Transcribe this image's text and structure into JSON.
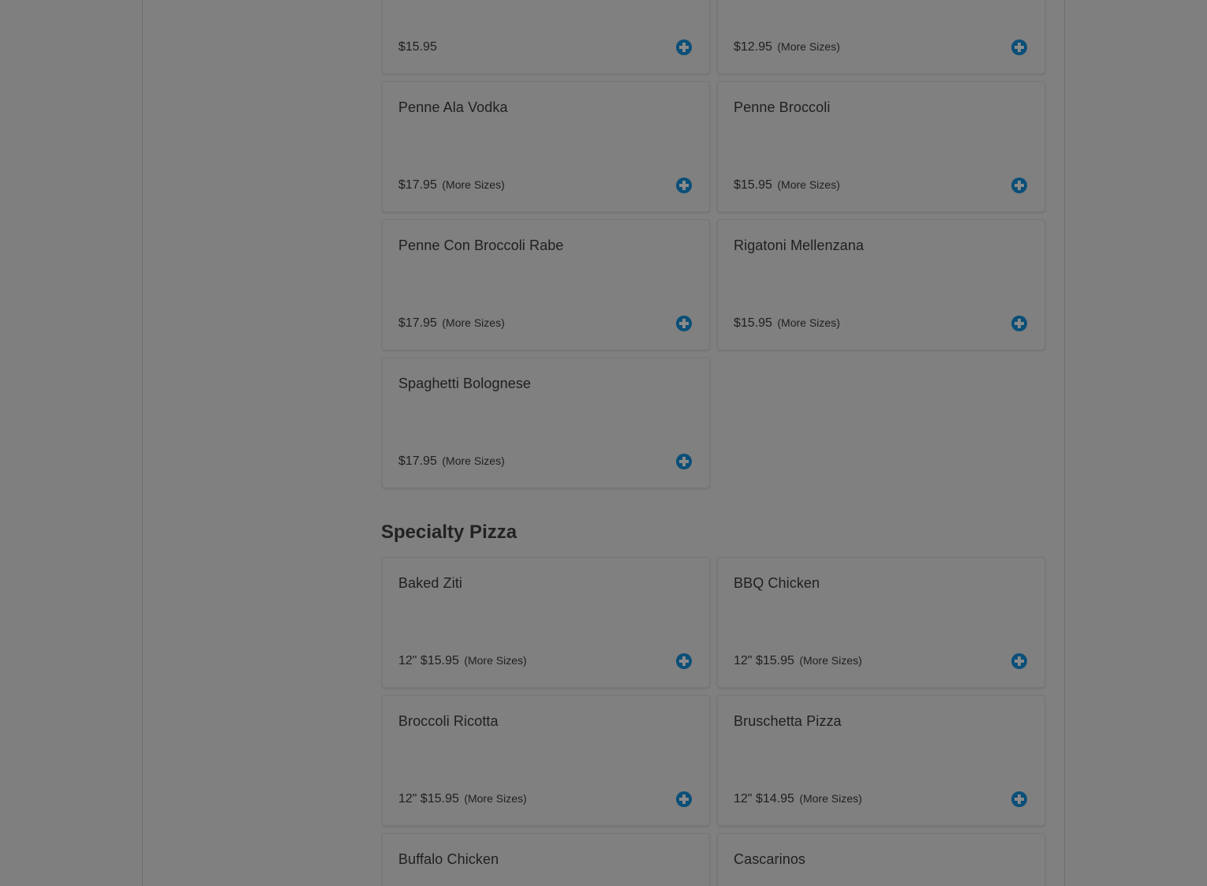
{
  "pasta": {
    "items": [
      {
        "name": "",
        "price": "$15.95",
        "more": ""
      },
      {
        "name": "",
        "price": "$12.95",
        "more": "(More Sizes)"
      },
      {
        "name": "Penne Ala Vodka",
        "price": "$17.95",
        "more": "(More Sizes)"
      },
      {
        "name": "Penne Broccoli",
        "price": "$15.95",
        "more": "(More Sizes)"
      },
      {
        "name": "Penne Con Broccoli Rabe",
        "price": "$17.95",
        "more": "(More Sizes)"
      },
      {
        "name": "Rigatoni Mellenzana",
        "price": "$15.95",
        "more": "(More Sizes)"
      },
      {
        "name": "Spaghetti Bolognese",
        "price": "$17.95",
        "more": "(More Sizes)"
      }
    ]
  },
  "specialty_pizza": {
    "title": "Specialty Pizza",
    "items": [
      {
        "name": "Baked Ziti",
        "price": "12\" $15.95",
        "more": "(More Sizes)"
      },
      {
        "name": "BBQ Chicken",
        "price": "12\" $15.95",
        "more": "(More Sizes)"
      },
      {
        "name": "Broccoli Ricotta",
        "price": "12\" $15.95",
        "more": "(More Sizes)"
      },
      {
        "name": "Bruschetta Pizza",
        "price": "12\" $14.95",
        "more": "(More Sizes)"
      },
      {
        "name": "Buffalo Chicken",
        "price": "",
        "more": ""
      },
      {
        "name": "Cascarinos",
        "price": "",
        "more": ""
      }
    ]
  },
  "icons": {
    "add": "plus-circle-icon"
  },
  "colors": {
    "accent": "#0a4f78",
    "overlay_bg": "#808080"
  }
}
